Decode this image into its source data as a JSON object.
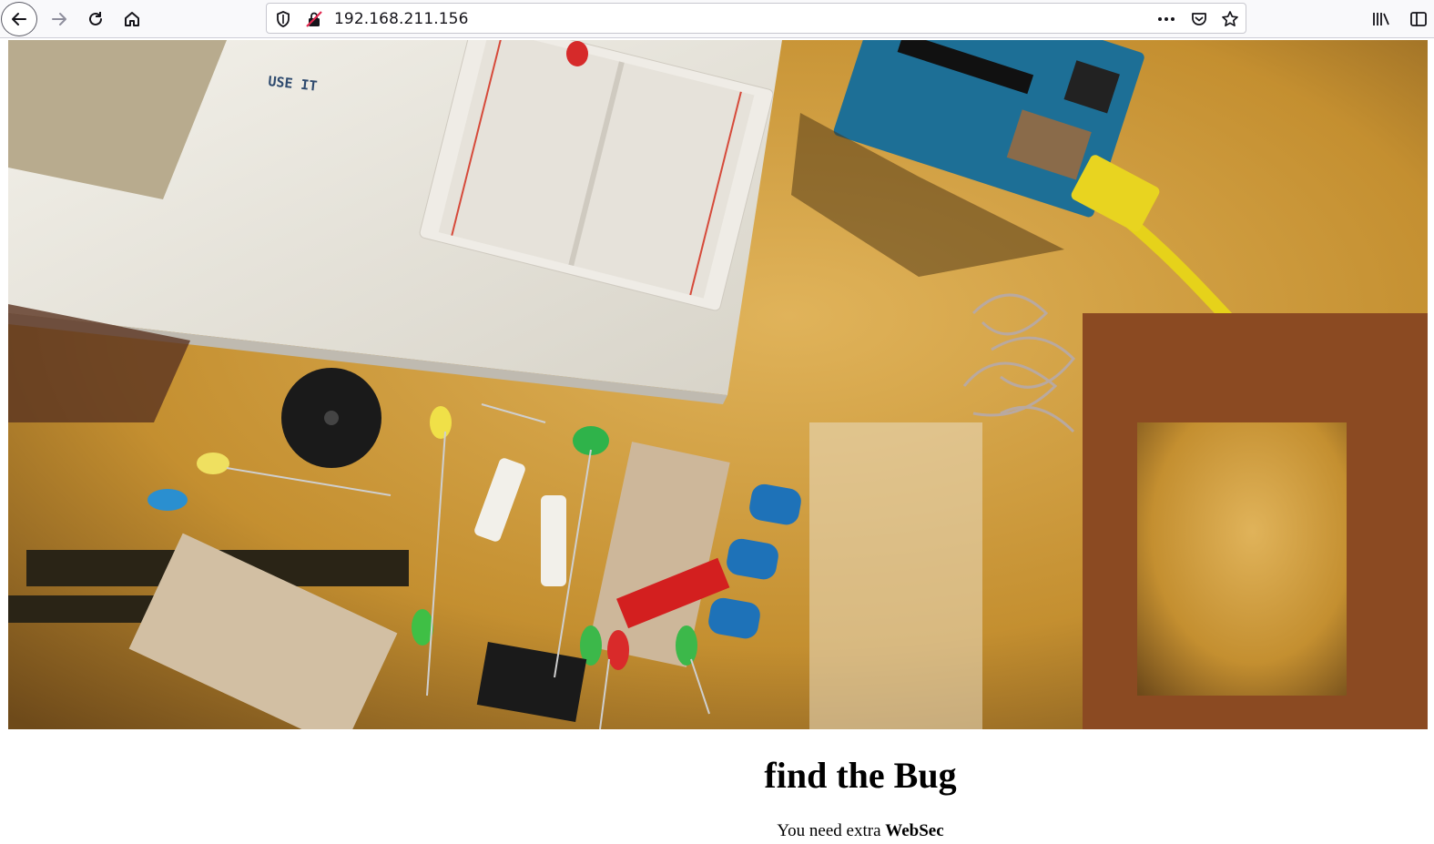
{
  "browser": {
    "url": "192.168.211.156",
    "icons": {
      "back": "arrow-left-icon",
      "forward": "arrow-right-icon",
      "reload": "reload-icon",
      "home": "home-icon",
      "tracking": "shield-icon",
      "insecure": "insecure-lock-icon",
      "menu": "more-dots-icon",
      "pocket": "pocket-icon",
      "bookmark": "star-icon",
      "library": "library-icon",
      "sidebar": "sidebar-icon"
    }
  },
  "page": {
    "hero_image": "electronics-components-photo",
    "title": "find the Bug",
    "text_prefix": "You need extra ",
    "text_bold": "WebSec"
  },
  "colors": {
    "toolbar_bg": "#f9f9fb",
    "desk": "#c9952f",
    "title": "#000000"
  }
}
